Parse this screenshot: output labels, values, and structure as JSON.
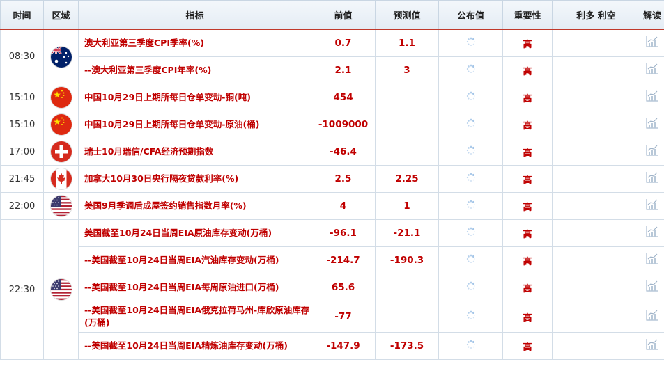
{
  "header": {
    "time": "时间",
    "region": "区域",
    "indicator": "指标",
    "previous": "前值",
    "forecast": "预测值",
    "actual": "公布值",
    "importance": "重要性",
    "effect": "利多 利空",
    "analysis": "解读"
  },
  "time_groups": [
    {
      "time": "08:30",
      "flag": "australia-flag",
      "rows": [
        0,
        1
      ]
    },
    {
      "time": "15:10",
      "flag": "china-flag",
      "rows": [
        2
      ]
    },
    {
      "time": "15:10",
      "flag": "china-flag",
      "rows": [
        3
      ]
    },
    {
      "time": "17:00",
      "flag": "switzerland-flag",
      "rows": [
        4
      ]
    },
    {
      "time": "21:45",
      "flag": "canada-flag",
      "rows": [
        5
      ]
    },
    {
      "time": "22:00",
      "flag": "usa-flag",
      "rows": [
        6
      ]
    },
    {
      "time": "22:30",
      "flag": "usa-flag",
      "rows": [
        7,
        8,
        9,
        10,
        11
      ]
    }
  ],
  "rows": [
    {
      "indicator": "澳大利亚第三季度CPI季率(%)",
      "previous": "0.7",
      "forecast": "1.1",
      "importance": "高"
    },
    {
      "indicator": "--澳大利亚第三季度CPI年率(%)",
      "previous": "2.1",
      "forecast": "3",
      "importance": "高"
    },
    {
      "indicator": "中国10月29日上期所每日仓单变动-铜(吨)",
      "previous": "454",
      "forecast": "",
      "importance": "高"
    },
    {
      "indicator": "中国10月29日上期所每日仓单变动-原油(桶)",
      "previous": "-1009000",
      "forecast": "",
      "importance": "高"
    },
    {
      "indicator": "瑞士10月瑞信/CFA经济预期指数",
      "previous": "-46.4",
      "forecast": "",
      "importance": "高"
    },
    {
      "indicator": "加拿大10月30日央行隔夜贷款利率(%)",
      "previous": "2.5",
      "forecast": "2.25",
      "importance": "高"
    },
    {
      "indicator": "美国9月季调后成屋签约销售指数月率(%)",
      "previous": "4",
      "forecast": "1",
      "importance": "高"
    },
    {
      "indicator": "美国截至10月24日当周EIA原油库存变动(万桶)",
      "previous": "-96.1",
      "forecast": "-21.1",
      "importance": "高"
    },
    {
      "indicator": "--美国截至10月24日当周EIA汽油库存变动(万桶)",
      "previous": "-214.7",
      "forecast": "-190.3",
      "importance": "高"
    },
    {
      "indicator": "--美国截至10月24日当周EIA每周原油进口(万桶)",
      "previous": "65.6",
      "forecast": "",
      "importance": "高"
    },
    {
      "indicator": "--美国截至10月24日当周EIA俄克拉荷马州-库欣原油库存(万桶)",
      "previous": "-77",
      "forecast": "",
      "importance": "高"
    },
    {
      "indicator": "--美国截至10月24日当周EIA精炼油库存变动(万桶)",
      "previous": "-147.9",
      "forecast": "-173.5",
      "importance": "高"
    }
  ],
  "colors": {
    "accent": "#c00000",
    "header_border": "#c0392b",
    "grid": "#d3dde7"
  },
  "icons": {
    "actual": "loading-spinner-icon",
    "analysis": "chart-analysis-icon"
  }
}
